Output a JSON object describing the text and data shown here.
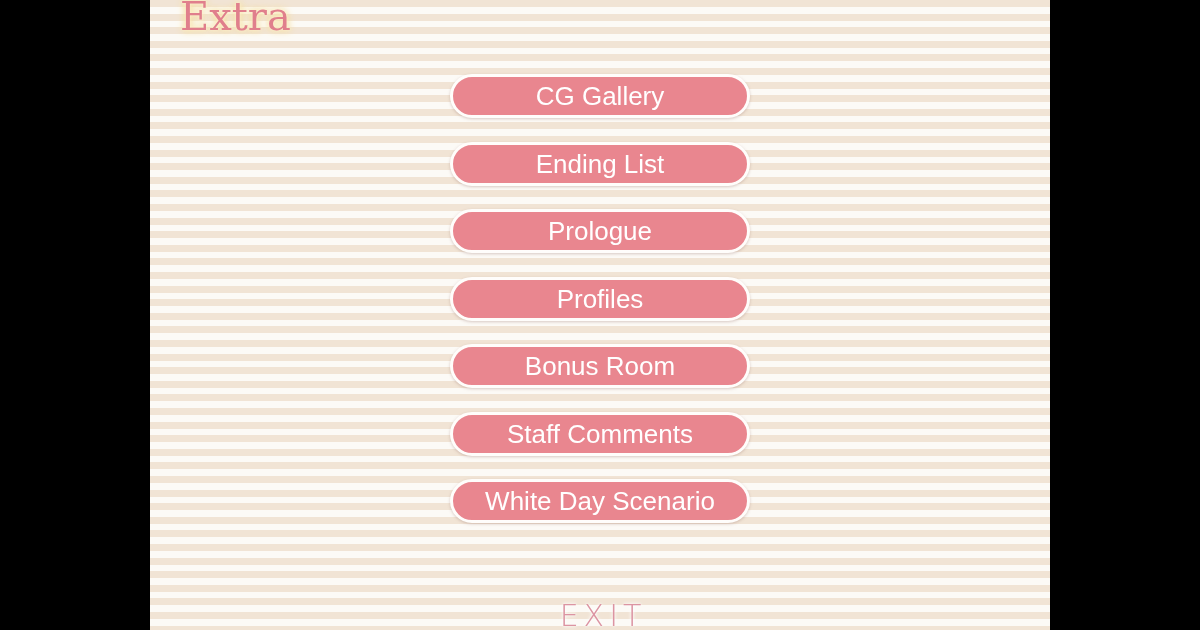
{
  "title": "Extra",
  "menu": [
    {
      "label": "CG Gallery"
    },
    {
      "label": "Ending List"
    },
    {
      "label": "Prologue"
    },
    {
      "label": "Profiles"
    },
    {
      "label": "Bonus Room"
    },
    {
      "label": "Staff Comments"
    },
    {
      "label": "White Day Scenario"
    }
  ],
  "exit": "EXIT"
}
